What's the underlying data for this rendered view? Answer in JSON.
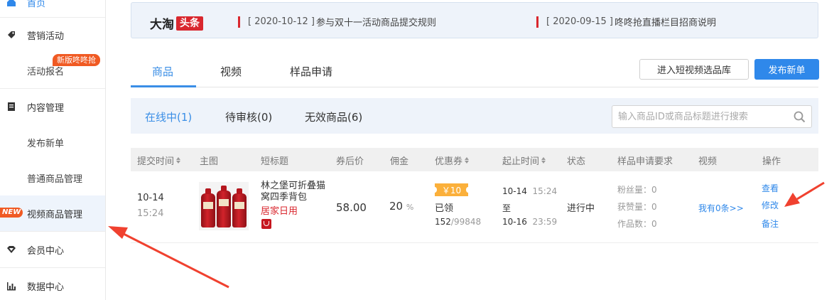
{
  "sidebar": {
    "top_cut": "首页",
    "marketing": "营销活动",
    "activity_signup": "活动报名",
    "hot_badge": "新版咚咚抢",
    "content_mgmt": "内容管理",
    "publish_new": "发布新单",
    "normal_goods_mgmt": "普通商品管理",
    "new_badge": "NEW",
    "video_goods_mgmt": "视频商品管理",
    "member_center": "会员中心",
    "data_center": "数据中心"
  },
  "notice": {
    "logo_main": "大淘",
    "logo_tag": "头条",
    "items": [
      {
        "date": "[ 2020-10-12 ]",
        "title": "参与双十一活动商品提交规则"
      },
      {
        "date": "[ 2020-09-15 ]",
        "title": "咚咚抢直播栏目招商说明"
      }
    ]
  },
  "tabs": [
    "商品",
    "视频",
    "样品申请"
  ],
  "active_tab": "商品",
  "buttons": {
    "video_library": "进入短视频选品库",
    "publish": "发布新单"
  },
  "subtabs": [
    "在线中(1)",
    "待审核(0)",
    "无效商品(6)"
  ],
  "search": {
    "placeholder": "输入商品ID或商品标题进行搜索",
    "value": ""
  },
  "table": {
    "headers": [
      "提交时间",
      "主图",
      "短标题",
      "券后价",
      "佣金",
      "优惠券",
      "起止时间",
      "状态",
      "样品申请要求",
      "视频",
      "操作"
    ],
    "row": {
      "submit_date": "10-14",
      "submit_time": "15:24",
      "title_line1": "林之堡可折叠猫",
      "title_line2": "窝四季背包",
      "category": "居家日用",
      "price": "58.00",
      "commission": "20",
      "commission_unit": "%",
      "coupon_amount": "￥10",
      "coupon_status": "已领",
      "coupon_used": "152",
      "coupon_total": "/99848",
      "start_date": "10-14",
      "start_time": "15:24",
      "to": "至",
      "end_date": "10-16",
      "end_time": "23:59",
      "status": "进行中",
      "req_fans": "粉丝量：0",
      "req_likes": "获赞量：0",
      "req_works": "作品数：0",
      "video_link": "我有0条>>",
      "op_view": "查看",
      "op_edit": "修改",
      "op_note": "备注"
    }
  },
  "colors": {
    "primary": "#2f88ea",
    "annotation": "#f0412f",
    "badge": "#f05a23"
  }
}
